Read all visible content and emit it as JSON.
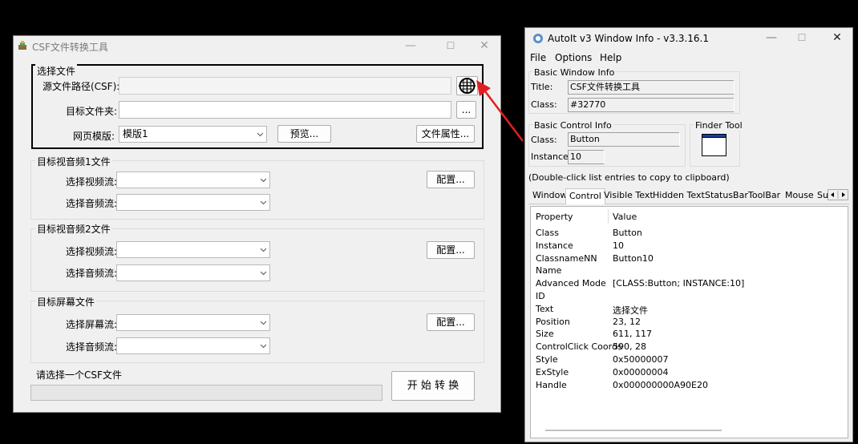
{
  "csf": {
    "title": "CSF文件转换工具",
    "select_group": {
      "title": "选择文件",
      "source_label": "源文件路径(CSF):",
      "target_label": "目标文件夹:",
      "browse_label": "...",
      "template_label": "网页模版:",
      "template_value": "模版1",
      "preview_label": "预览...",
      "props_label": "文件属性..."
    },
    "av1_group": {
      "title": "目标视音频1文件",
      "video_label": "选择视频流:",
      "audio_label": "选择音频流:",
      "config_label": "配置..."
    },
    "av2_group": {
      "title": "目标视音频2文件",
      "video_label": "选择视频流:",
      "audio_label": "选择音频流:",
      "config_label": "配置..."
    },
    "screen_group": {
      "title": "目标屏幕文件",
      "screen_label": "选择屏幕流:",
      "audio_label": "选择音频流:",
      "config_label": "配置..."
    },
    "status": "请选择一个CSF文件",
    "start_label": "开 始 转 换",
    "window_buttons": {
      "minimize": "—",
      "maximize": "☐",
      "close": "✕"
    }
  },
  "autoit": {
    "title": "AutoIt v3 Window Info - v3.3.16.1",
    "window_buttons": {
      "minimize": "—",
      "maximize": "☐",
      "close": "✕"
    },
    "menu": [
      "File",
      "Options",
      "Help"
    ],
    "basic_window": {
      "title": "Basic Window Info",
      "title_label": "Title:",
      "title_value": "CSF文件转换工具",
      "class_label": "Class:",
      "class_value": "#32770"
    },
    "basic_control": {
      "title": "Basic Control Info",
      "class_label": "Class:",
      "class_value": "Button",
      "instance_label": "Instance:",
      "instance_value": "10"
    },
    "finder_tool": {
      "title": "Finder Tool"
    },
    "hint": "(Double-click list entries to copy to clipboard)",
    "tabs": [
      "Window",
      "Control",
      "Visible Text",
      "Hidden Text",
      "StatusBar",
      "ToolBar",
      "Mouse",
      "Su"
    ],
    "active_tab": "Control",
    "list": {
      "header": {
        "property": "Property",
        "value": "Value"
      },
      "rows": [
        {
          "property": "Class",
          "value": "Button"
        },
        {
          "property": "Instance",
          "value": "10"
        },
        {
          "property": "ClassnameNN",
          "value": "Button10"
        },
        {
          "property": "Name",
          "value": ""
        },
        {
          "property": "Advanced Mode",
          "value": "[CLASS:Button; INSTANCE:10]"
        },
        {
          "property": "ID",
          "value": ""
        },
        {
          "property": "Text",
          "value": "选择文件"
        },
        {
          "property": "Position",
          "value": "23, 12"
        },
        {
          "property": "Size",
          "value": "611, 117"
        },
        {
          "property": "ControlClick Coords",
          "value": "590, 28"
        },
        {
          "property": "Style",
          "value": "0x50000007"
        },
        {
          "property": "ExStyle",
          "value": "0x00000004"
        },
        {
          "property": "Handle",
          "value": "0x000000000A90E20"
        }
      ]
    }
  },
  "colors": {
    "highlight_arrow": "#e02020",
    "accent": "#0078d7"
  }
}
